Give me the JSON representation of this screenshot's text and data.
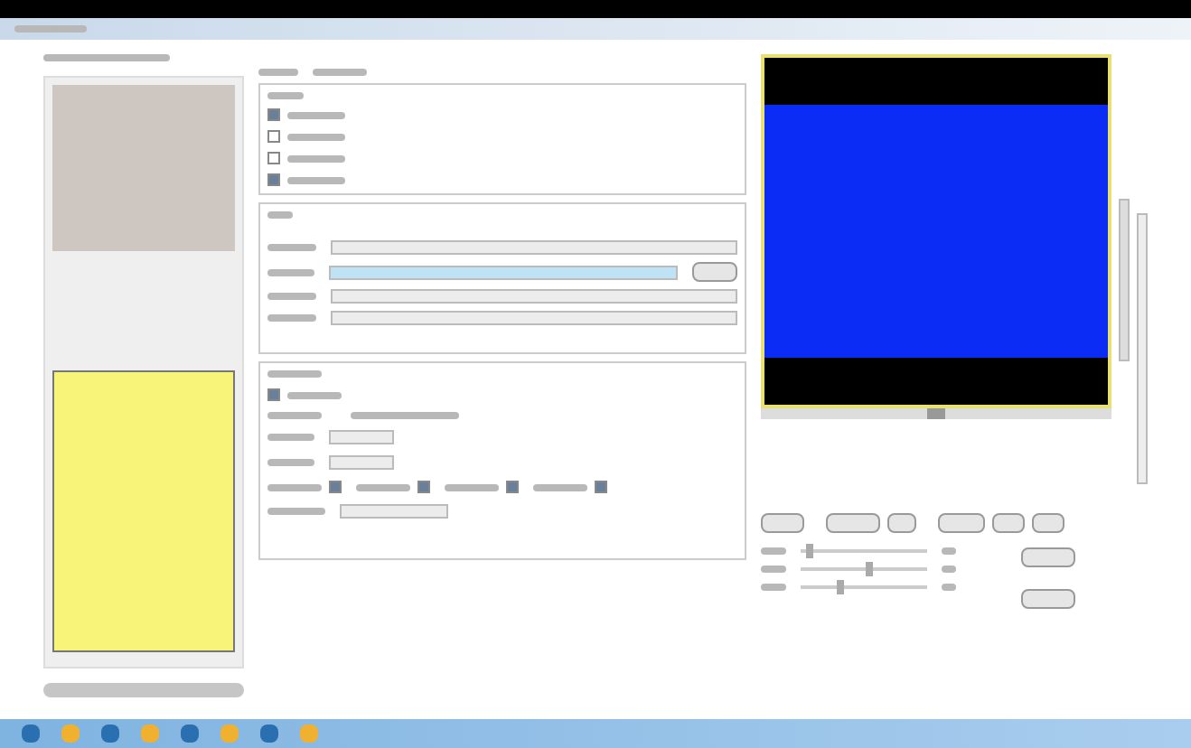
{
  "acquisition_options": [
    {
      "checked": true
    },
    {
      "checked": false
    },
    {
      "checked": false
    },
    {
      "checked": true
    }
  ],
  "device_dropdowns": [
    {
      "focused": false
    },
    {
      "focused": true
    },
    {
      "focused": false
    },
    {
      "focused": false
    }
  ],
  "processing_options": [
    {
      "checked": true
    },
    {
      "checked": true
    },
    {
      "checked": true
    },
    {
      "checked": true
    },
    {
      "checked": true
    }
  ],
  "sliders": [
    {
      "level": 0.05
    },
    {
      "level": 0.55
    },
    {
      "level": 0.3
    }
  ],
  "preview_scroll": {
    "level": 0.5
  }
}
